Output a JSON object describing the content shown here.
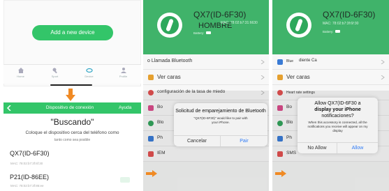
{
  "panel1": {
    "add_device_label": "Add a new device",
    "nav": [
      {
        "label": "Home",
        "icon": "home-icon"
      },
      {
        "label": "Sport",
        "icon": "sport-icon"
      },
      {
        "label": "Device",
        "icon": "device-icon"
      },
      {
        "label": "Profile",
        "icon": "profile-icon"
      }
    ],
    "header_title": "Dispositivo de conexión",
    "header_help": "Ayuda",
    "searching": "\"Buscando\"",
    "hint": "Coloque el dispositivo cerca del teléfono como",
    "hint2": "tanto como sea posible",
    "devices": [
      {
        "name": "QX7(ID-6F30)",
        "mac": "MAC: 78:02:b7:3f:6f:30"
      },
      {
        "name": "P21(ID-86EE)",
        "mac": "MAC: 78:02:b7:3f:86:ee"
      }
    ]
  },
  "panel2": {
    "device_title": "QX7(ID-6F30)",
    "device_sub": "HOMBRE",
    "mac": "MAC: 78:02:b7:31:6630",
    "battery_label": "Battery:",
    "rows": [
      {
        "label": "o Llamada Bluetooth",
        "color": "#3a7bd5"
      },
      {
        "label": "Ver caras",
        "color": "#e5a030"
      },
      {
        "label": "configuración de la tasa de miedo",
        "color": "#e05050"
      },
      {
        "label": "Bo",
        "color": "#d94c8a"
      },
      {
        "label": "Blo",
        "color": "#33a35c"
      },
      {
        "label": "Ph",
        "color": "#3a7bd5"
      },
      {
        "label": "IEM",
        "color": "#e05050"
      }
    ],
    "dialog": {
      "title": "Solicitud de emparejamiento de Bluetooth",
      "body": "\"QX7(ID-6F30)\" would like to pair with your iPhone.",
      "cancel": "Cancelar",
      "pair": "Pair"
    }
  },
  "panel3": {
    "device_title": "QX7(ID-6F30)",
    "mac": "MAC: 78:02:b7:3f:6f:30",
    "battery_label": "Battery:",
    "rows": [
      {
        "label": "Blue",
        "label2": "diente Ca",
        "color": "#3a7bd5"
      },
      {
        "label": "Ver caras",
        "color": "#e5a030"
      },
      {
        "label": "Heart rate settings",
        "color": "#e05050"
      },
      {
        "label": "Bo",
        "color": "#d94c8a"
      },
      {
        "label": "Blo",
        "color": "#33a35c"
      },
      {
        "label": "Ph",
        "color": "#3a7bd5"
      },
      {
        "label": "SMS",
        "color": "#e05050"
      }
    ],
    "dialog": {
      "title1": "Allow QX7(ID-6F30 a",
      "title2": "display your iPhone",
      "title3": "notificaciones?",
      "body": "When this accessory is connected, all the notifications you receive will appear on my display",
      "deny": "No Allow",
      "allow": "Allow"
    }
  },
  "colors": {
    "green": "#40b36a",
    "accent_blue": "#2f7bf5",
    "arrow": "#f08a24"
  }
}
